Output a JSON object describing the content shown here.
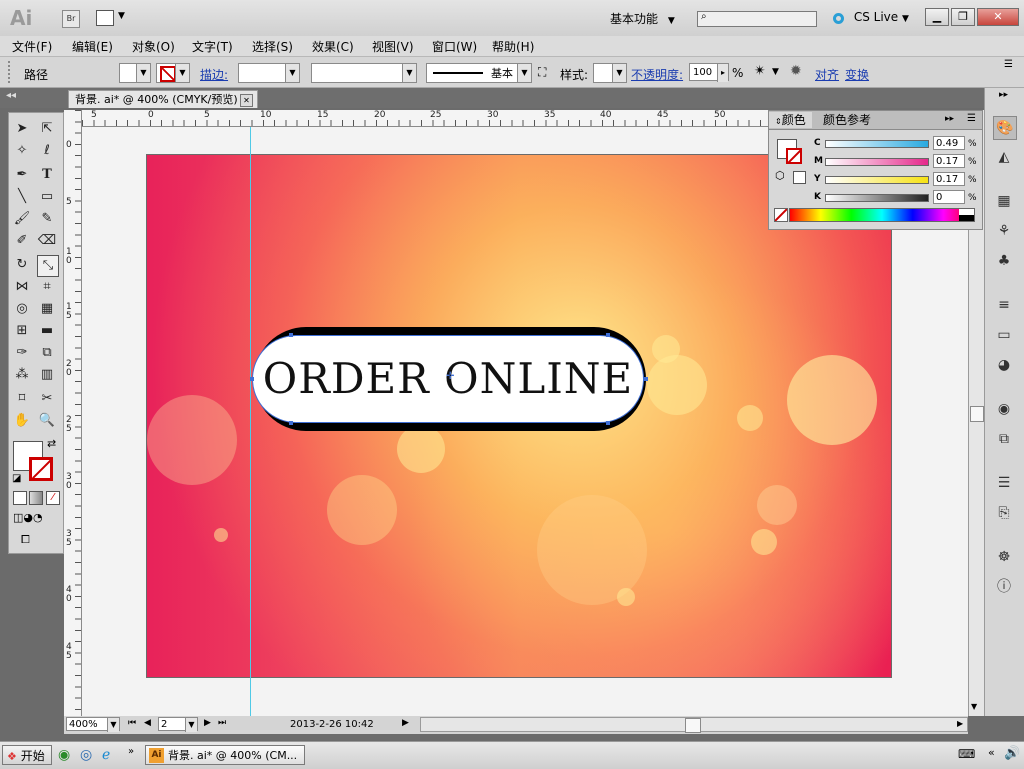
{
  "app": {
    "logo": "Ai",
    "bridge": "Br",
    "workspace": "基本功能",
    "cslive": "CS Live"
  },
  "window_controls": {
    "minimize": "▁",
    "restore": "❐",
    "close": "✕"
  },
  "menu": [
    "文件(F)",
    "编辑(E)",
    "对象(O)",
    "文字(T)",
    "选择(S)",
    "效果(C)",
    "视图(V)",
    "窗口(W)",
    "帮助(H)"
  ],
  "control_bar": {
    "selection": "路径",
    "stroke_label": "描边:",
    "stroke_style": "基本",
    "style_label": "样式:",
    "opacity_label": "不透明度:",
    "opacity_value": "100",
    "opacity_unit": "%",
    "align_label": "对齐",
    "transform_label": "变换"
  },
  "document_tab": {
    "title": "背景. ai* @ 400% (CMYK/预览)",
    "close": "✕"
  },
  "ruler": {
    "h_labels": [
      "5",
      "0",
      "5",
      "10",
      "15",
      "20",
      "25",
      "30",
      "35",
      "40",
      "45",
      "50"
    ],
    "v_labels": [
      "0",
      "5",
      "1 0",
      "1 5",
      "2 0",
      "2 5",
      "3 0",
      "3 5",
      "4 0",
      "4 5"
    ]
  },
  "artwork": {
    "button_text": "ORDER ONLINE"
  },
  "color_panel": {
    "tab_color": "颜色",
    "tab_guide": "颜色参考",
    "channels": [
      {
        "label": "C",
        "value": "0.49",
        "color": "#29a9e0"
      },
      {
        "label": "M",
        "value": "0.17",
        "color": "#e5288b"
      },
      {
        "label": "Y",
        "value": "0.17",
        "color": "#f6e214"
      },
      {
        "label": "K",
        "value": "0",
        "color": "#222222"
      }
    ],
    "unit": "%"
  },
  "status_bar": {
    "zoom": "400%",
    "artboard": "2",
    "timestamp": "2013-2-26  10:42"
  },
  "taskbar": {
    "start": "开始",
    "task_title": "背景. ai* @ 400% (CM..."
  }
}
